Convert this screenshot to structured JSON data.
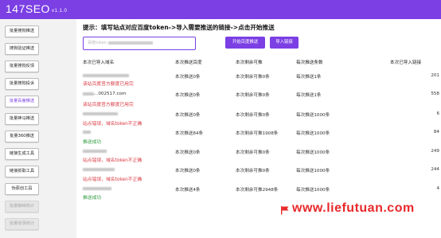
{
  "app": {
    "name": "147SEO",
    "version": "v1.1.0"
  },
  "sidebar": {
    "items": [
      {
        "label": "批量搜狗推送",
        "state": "normal"
      },
      {
        "label": "搜狗验证推送",
        "state": "normal"
      },
      {
        "label": "批量搜狗反馈",
        "state": "normal"
      },
      {
        "label": "批量搜狗投诉",
        "state": "normal"
      },
      {
        "label": "批量百度推送",
        "state": "active"
      },
      {
        "label": "批量神马推送",
        "state": "normal"
      },
      {
        "label": "批量360推送",
        "state": "normal"
      },
      {
        "label": "链接生成工具",
        "state": "normal"
      },
      {
        "label": "链接抓取工具",
        "state": "normal"
      },
      {
        "label": "伪原创工具",
        "state": "normal"
      },
      {
        "label": "批量蜘蛛统计",
        "state": "disabled"
      },
      {
        "label": "批量收录统计",
        "state": "disabled"
      }
    ]
  },
  "main": {
    "hint": "提示：填写站点对应百度token->导入需要推送的链接->点击开始推送",
    "token_placeholder": "百度token",
    "start_button": "开始百度推送",
    "import_button": "导入链接",
    "columns": [
      "本次已导入域名",
      "本次推送百度",
      "本次剩余可推",
      "每次推送条数",
      "本次已导入链接"
    ],
    "rows": [
      {
        "domain_suffix": "",
        "pushed": "本次推送0条",
        "remaining": "本次剩余可推0条",
        "per_push": "每次推送1条",
        "imported": "201",
        "status": "该站百度官方额度已用完",
        "status_type": "error"
      },
      {
        "domain_suffix": "...002517.com",
        "pushed": "本次推送0条",
        "remaining": "本次剩余可推0条",
        "per_push": "每次推送1条",
        "imported": "558",
        "status": "该站百度官方额度已用完",
        "status_type": "error"
      },
      {
        "domain_suffix": "",
        "pushed": "本次推送0条",
        "remaining": "本次剩余可推0条",
        "per_push": "每次推送1000条",
        "imported": "6",
        "status": "站点错误，域名token不正确",
        "status_type": "error"
      },
      {
        "domain_suffix": "",
        "pushed": "本次推送84条",
        "remaining": "本次剩余可推1908条",
        "per_push": "每次推送1000条",
        "imported": "84",
        "status": "推送成功",
        "status_type": "ok"
      },
      {
        "domain_suffix": "",
        "pushed": "本次推送0条",
        "remaining": "本次剩余可推0条",
        "per_push": "每次推送1000条",
        "imported": "249",
        "status": "站点错误，域名token不正确",
        "status_type": "error"
      },
      {
        "domain_suffix": "",
        "pushed": "本次推送0条",
        "remaining": "本次剩余可推0条",
        "per_push": "每次推送1000条",
        "imported": "244",
        "status": "站点错误，域名token不正确",
        "status_type": "error"
      },
      {
        "domain_suffix": "",
        "pushed": "本次推送4条",
        "remaining": "本次剩余可推2948条",
        "per_push": "每次推送1000条",
        "imported": "4",
        "status": "推送成功",
        "status_type": "ok"
      }
    ]
  },
  "watermark": "www.liefutuan.com",
  "colors": {
    "accent": "#7b3fe4",
    "error": "#d9363e",
    "success": "#2e9b3f",
    "watermark": "#e8292b"
  }
}
